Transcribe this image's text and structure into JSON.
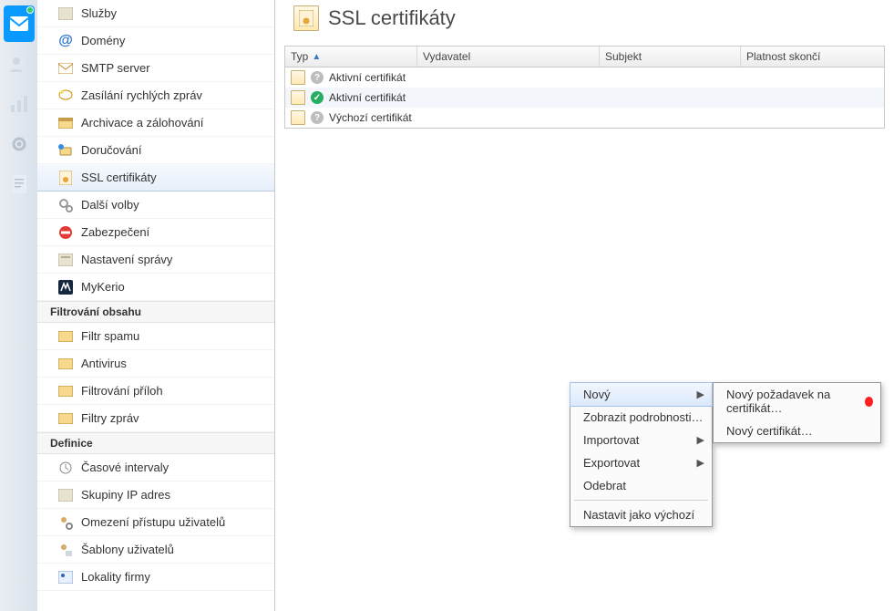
{
  "rail": [
    {
      "name": "mail-icon",
      "active": true,
      "dot": true
    },
    {
      "name": "users-icon",
      "active": false,
      "dot": false
    },
    {
      "name": "stats-icon",
      "active": false,
      "dot": false
    },
    {
      "name": "gear-icon",
      "active": false,
      "dot": false
    },
    {
      "name": "doc-icon",
      "active": false,
      "dot": false
    }
  ],
  "sidebar": {
    "configItems": [
      {
        "label": "Služby",
        "icon": "book-icon"
      },
      {
        "label": "Domény",
        "icon": "at-icon"
      },
      {
        "label": "SMTP server",
        "icon": "smtp-icon"
      },
      {
        "label": "Zasílání rychlých zpráv",
        "icon": "im-icon"
      },
      {
        "label": "Archivace a zálohování",
        "icon": "archive-icon"
      },
      {
        "label": "Doručování",
        "icon": "delivery-icon"
      },
      {
        "label": "SSL certifikáty",
        "icon": "cert-icon",
        "selected": true
      },
      {
        "label": "Další volby",
        "icon": "gears-icon"
      },
      {
        "label": "Zabezpečení",
        "icon": "no-entry-icon"
      },
      {
        "label": "Nastavení správy",
        "icon": "admin-icon"
      },
      {
        "label": "MyKerio",
        "icon": "mykerio-icon"
      }
    ],
    "filterHeader": "Filtrování obsahu",
    "filterItems": [
      {
        "label": "Filtr spamu",
        "icon": "folder-icon"
      },
      {
        "label": "Antivirus",
        "icon": "folder-icon"
      },
      {
        "label": "Filtrování příloh",
        "icon": "folder-icon"
      },
      {
        "label": "Filtry zpráv",
        "icon": "folder-icon"
      }
    ],
    "defHeader": "Definice",
    "defItems": [
      {
        "label": "Časové intervaly",
        "icon": "clock-icon"
      },
      {
        "label": "Skupiny IP adres",
        "icon": "book-icon"
      },
      {
        "label": "Omezení přístupu uživatelů",
        "icon": "usergear-icon"
      },
      {
        "label": "Šablony uživatelů",
        "icon": "template-icon"
      },
      {
        "label": "Lokality firmy",
        "icon": "map-icon"
      }
    ]
  },
  "page": {
    "title": "SSL certifikáty"
  },
  "table": {
    "columns": {
      "type": "Typ",
      "issuer": "Vydavatel",
      "subject": "Subjekt",
      "expires": "Platnost skončí"
    },
    "rows": [
      {
        "status": "q",
        "label": "Aktivní certifikát"
      },
      {
        "status": "ok",
        "label": "Aktivní certifikát"
      },
      {
        "status": "q",
        "label": "Výchozí certifikát"
      }
    ]
  },
  "ctx": {
    "items": [
      {
        "label": "Nový",
        "arrow": true,
        "hover": true
      },
      {
        "label": "Zobrazit podrobnosti…",
        "arrow": false
      },
      {
        "label": "Importovat",
        "arrow": true
      },
      {
        "label": "Exportovat",
        "arrow": true
      },
      {
        "label": "Odebrat",
        "arrow": false
      }
    ],
    "setDefault": "Nastavit jako výchozí"
  },
  "sub": {
    "items": [
      {
        "label": "Nový požadavek na certifikát…",
        "marker": true
      },
      {
        "label": "Nový certifikát…",
        "marker": false
      }
    ]
  }
}
